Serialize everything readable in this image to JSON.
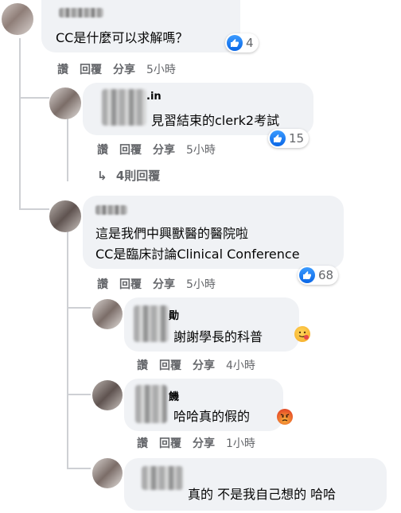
{
  "comments": [
    {
      "name_suffix": "",
      "text": "CC是什麼可以求解嗎？",
      "reactions": "4",
      "time": "5小時"
    },
    {
      "name_suffix": ".in",
      "text": "見習結束的clerk2考試",
      "reactions": "15",
      "time": "5小時"
    },
    {
      "name_suffix": "",
      "text_line1": "這是我們中興獸醫的醫院啦",
      "text_line2": "CC是臨床討論Clinical Conference",
      "reactions": "68",
      "time": "5小時"
    },
    {
      "name_suffix": "勛",
      "text": "謝謝學長的科普",
      "time": "4小時",
      "emoji": "hug-emoji"
    },
    {
      "name_suffix": "饑",
      "text": "哈哈真的假的",
      "time": "1小時",
      "emoji": "angry-emoji"
    },
    {
      "name_suffix": "",
      "text": "真的 不是我自己想的 哈哈"
    }
  ],
  "actions": {
    "like": "讚",
    "reply": "回覆",
    "share": "分享"
  },
  "more_replies": "4則回覆",
  "colors": {
    "bubble": "#f0f2f5",
    "like_blue": "#1877f2",
    "meta_gray": "#65676b"
  }
}
